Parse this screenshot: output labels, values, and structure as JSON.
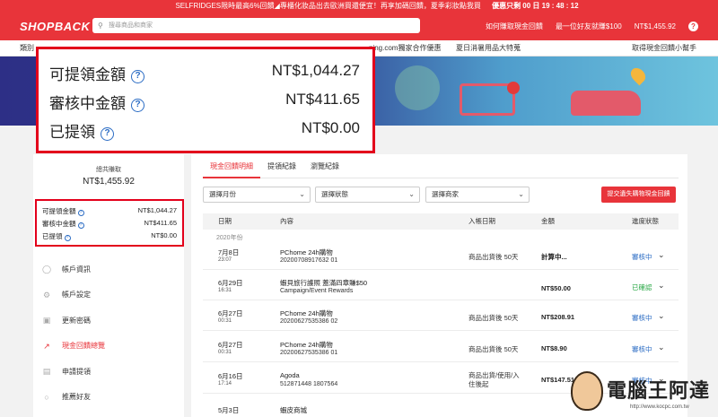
{
  "banner": {
    "promo": "SELFRIDGES限時最高6%回饋◢專櫃化妝品出去歐洲買還便宜！再享加碼回饋，夏季彩妝點我買",
    "timer": "優惠只剩 00 日 19 : 48 : 12"
  },
  "header": {
    "logo": "SHOPBACK",
    "search_placeholder": "搜尋商品和商家",
    "links": [
      "如何賺取現金回饋",
      "最一位好友就賺$100",
      "NT$1,455.92"
    ],
    "help": "?"
  },
  "nav": {
    "category": "類別",
    "mid": "ping.com獨家合作優惠",
    "mid2": "夏日消暑用品大特蒐",
    "helper": "取得現金回饋小幫手"
  },
  "callout": {
    "rows": [
      {
        "label": "可提領金額",
        "amount": "NT$1,044.27"
      },
      {
        "label": "審核中金額",
        "amount": "NT$411.65"
      },
      {
        "label": "已提領",
        "amount": "NT$0.00"
      }
    ]
  },
  "sidebar": {
    "total_label": "總共賺取",
    "total": "NT$1,455.92",
    "box": [
      {
        "label": "可提領金額",
        "amount": "NT$1,044.27"
      },
      {
        "label": "審核中金額",
        "amount": "NT$411.65"
      },
      {
        "label": "已提領",
        "amount": "NT$0.00"
      }
    ],
    "menu": [
      {
        "label": "帳戶資訊",
        "icon": "user-icon"
      },
      {
        "label": "帳戶設定",
        "icon": "gear-icon"
      },
      {
        "label": "更新密碼",
        "icon": "lock-icon"
      },
      {
        "label": "現金回饋總覽",
        "icon": "chart-icon",
        "active": true
      },
      {
        "label": "申請提領",
        "icon": "withdraw-icon"
      },
      {
        "label": "推薦好友",
        "icon": "friends-icon"
      }
    ]
  },
  "main": {
    "tabs": [
      "現金回饋明細",
      "提領紀錄",
      "瀏覽紀錄"
    ],
    "filters": [
      "選擇月份",
      "選擇狀態",
      "選擇商家"
    ],
    "submit_button": "提交遺失購物現金回饋",
    "columns": [
      "日期",
      "內容",
      "入帳日期",
      "金額",
      "進度狀態"
    ],
    "year": "2020年份",
    "rows": [
      {
        "date": "7月8日",
        "time": "23:07",
        "title": "PChome 24h購物",
        "sub": "20200708917632 01",
        "income": "商品出貨後 50天",
        "amount": "計算中...",
        "status": "審核中",
        "status_type": "pending"
      },
      {
        "date": "6月29日",
        "time": "16:31",
        "title": "蝦貝旅行護照 蓋滿四章賺$50",
        "sub": "Campaign/Event Rewards",
        "income": "",
        "amount": "NT$50.00",
        "status": "已確認",
        "status_type": "done"
      },
      {
        "date": "6月27日",
        "time": "00:31",
        "title": "PChome 24h購物",
        "sub": "20200627535386 02",
        "income": "商品出貨後 50天",
        "amount": "NT$208.91",
        "status": "審核中",
        "status_type": "pending"
      },
      {
        "date": "6月27日",
        "time": "00:31",
        "title": "PChome 24h購物",
        "sub": "20200627535386 01",
        "income": "商品出貨後 50天",
        "amount": "NT$8.90",
        "status": "審核中",
        "status_type": "pending"
      },
      {
        "date": "6月16日",
        "time": "17:14",
        "title": "Agoda",
        "sub": "512871448 1807564",
        "income": "商品出貨/使用/入住後起",
        "amount": "NT$147.51",
        "status": "審核中",
        "status_type": "pending"
      },
      {
        "date": "5月3日",
        "time": "",
        "title": "蝦皮商城",
        "sub": "",
        "income": "",
        "amount": "",
        "status": "",
        "status_type": "pending"
      }
    ]
  },
  "watermark": {
    "text": "電腦王阿達",
    "url": "http://www.kocpc.com.tw"
  },
  "colors": {
    "brand_red": "#e8343a",
    "highlight_red": "#e3001b",
    "pending_blue": "#2b6cc4",
    "done_green": "#28a745"
  }
}
